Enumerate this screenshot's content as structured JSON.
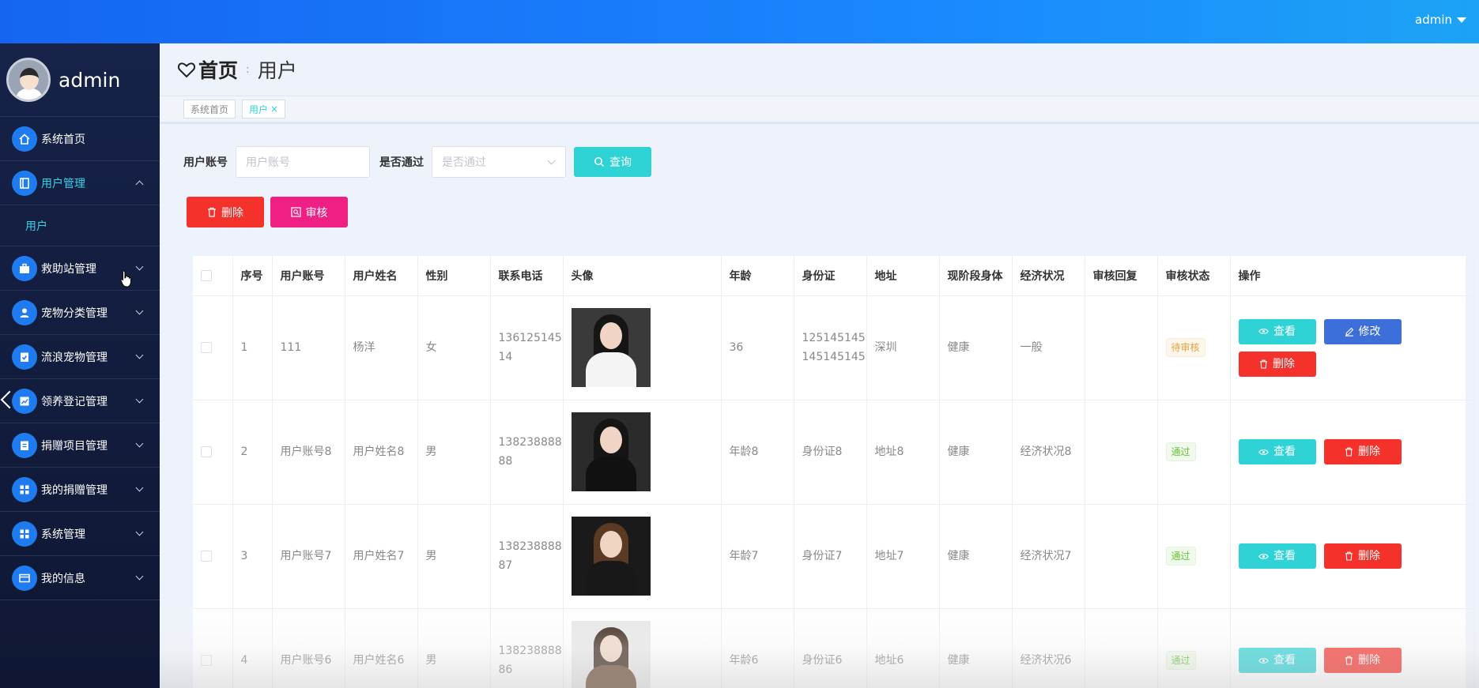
{
  "topbar": {
    "username": "admin"
  },
  "sidebar": {
    "profile_name": "admin",
    "items": [
      {
        "label": "系统首页",
        "icon": "home-icon"
      },
      {
        "label": "用户管理",
        "icon": "book-icon",
        "expanded": true,
        "sub": [
          "用户"
        ]
      },
      {
        "label": "救助站管理",
        "icon": "briefcase-icon"
      },
      {
        "label": "宠物分类管理",
        "icon": "user-icon"
      },
      {
        "label": "流浪宠物管理",
        "icon": "check-clipboard-icon"
      },
      {
        "label": "领养登记管理",
        "icon": "chart-icon"
      },
      {
        "label": "捐赠项目管理",
        "icon": "clipboard-icon"
      },
      {
        "label": "我的捐赠管理",
        "icon": "grid-icon"
      },
      {
        "label": "系统管理",
        "icon": "grid-icon"
      },
      {
        "label": "我的信息",
        "icon": "card-icon"
      }
    ]
  },
  "breadcrumb": {
    "home": "首页",
    "current": "用户"
  },
  "tags": [
    {
      "label": "系统首页"
    },
    {
      "label": "用户",
      "close": "×"
    }
  ],
  "search": {
    "account_label": "用户账号",
    "account_placeholder": "用户账号",
    "pass_label": "是否通过",
    "pass_placeholder": "是否通过",
    "query_label": "查询"
  },
  "actions": {
    "delete_label": "删除",
    "review_label": "审核"
  },
  "table": {
    "columns": [
      "序号",
      "用户账号",
      "用户姓名",
      "性别",
      "联系电话",
      "头像",
      "年龄",
      "身份证",
      "地址",
      "现阶段身体",
      "经济状况",
      "审核回复",
      "审核状态",
      "操作"
    ],
    "rows": [
      {
        "index": "1",
        "account": "111",
        "name": "杨洋",
        "gender": "女",
        "phone": "13612514514",
        "age": "36",
        "id_card": "125145145145145145",
        "address": "深圳",
        "health": "健康",
        "economy": "一般",
        "reply": "",
        "status": "待审核",
        "status_type": "wait",
        "ops": [
          "查看",
          "修改",
          "删除"
        ]
      },
      {
        "index": "2",
        "account": "用户账号8",
        "name": "用户姓名8",
        "gender": "男",
        "phone": "13823888888",
        "age": "年龄8",
        "id_card": "身份证8",
        "address": "地址8",
        "health": "健康",
        "economy": "经济状况8",
        "reply": "",
        "status": "通过",
        "status_type": "pass",
        "ops": [
          "查看",
          "删除"
        ]
      },
      {
        "index": "3",
        "account": "用户账号7",
        "name": "用户姓名7",
        "gender": "男",
        "phone": "13823888887",
        "age": "年龄7",
        "id_card": "身份证7",
        "address": "地址7",
        "health": "健康",
        "economy": "经济状况7",
        "reply": "",
        "status": "通过",
        "status_type": "pass",
        "ops": [
          "查看",
          "删除"
        ]
      },
      {
        "index": "4",
        "account": "用户账号6",
        "name": "用户姓名6",
        "gender": "男",
        "phone": "13823888886",
        "age": "年龄6",
        "id_card": "身份证6",
        "address": "地址6",
        "health": "健康",
        "economy": "经济状况6",
        "reply": "",
        "status": "通过",
        "status_type": "pass",
        "ops": [
          "查看",
          "删除"
        ]
      }
    ]
  }
}
